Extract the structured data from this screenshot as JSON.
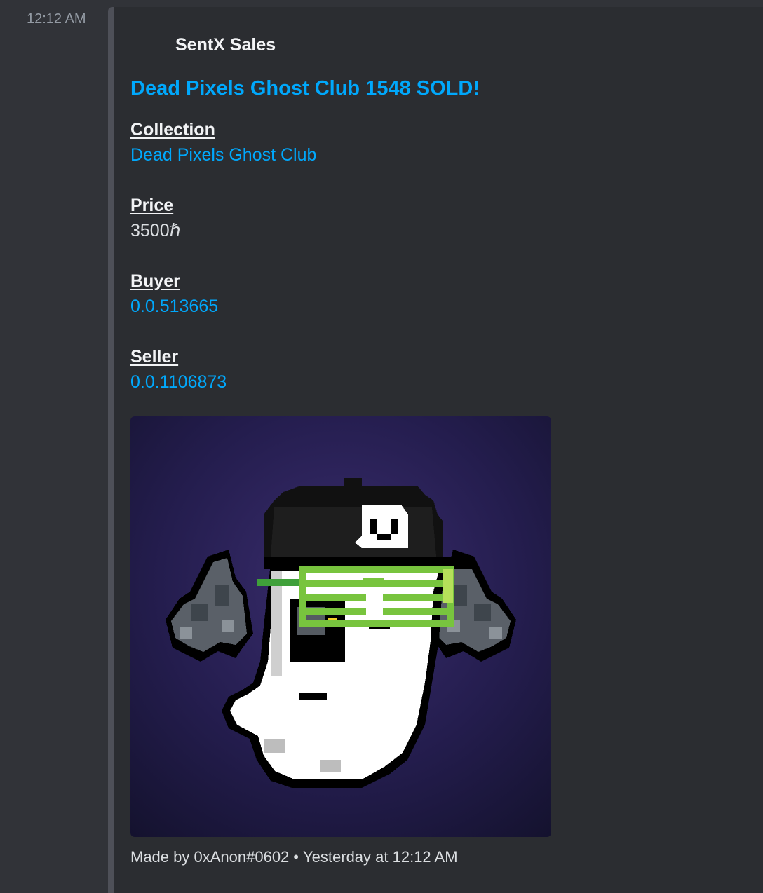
{
  "message": {
    "timestamp": "12:12 AM"
  },
  "embed": {
    "author": "SentX Sales",
    "title": "Dead Pixels Ghost Club 1548 SOLD!",
    "accent_color": "#4e5058",
    "fields": [
      {
        "name": "Collection",
        "value": "Dead Pixels Ghost Club",
        "is_link": true
      },
      {
        "name": "Price",
        "value": "3500ℏ",
        "is_link": false
      },
      {
        "name": "Buyer",
        "value": "0.0.513665",
        "is_link": true
      },
      {
        "name": "Seller",
        "value": "0.0.1106873",
        "is_link": true
      }
    ],
    "image": {
      "description": "pixel-art-ghost-nft"
    },
    "footer": {
      "made_by": "Made by 0xAnon#0602",
      "separator": "•",
      "time": "Yesterday at 12:12 AM"
    }
  },
  "colors": {
    "background": "#313338",
    "embed_background": "#2b2d31",
    "link": "#00a8fc",
    "text": "#dbdee1"
  }
}
